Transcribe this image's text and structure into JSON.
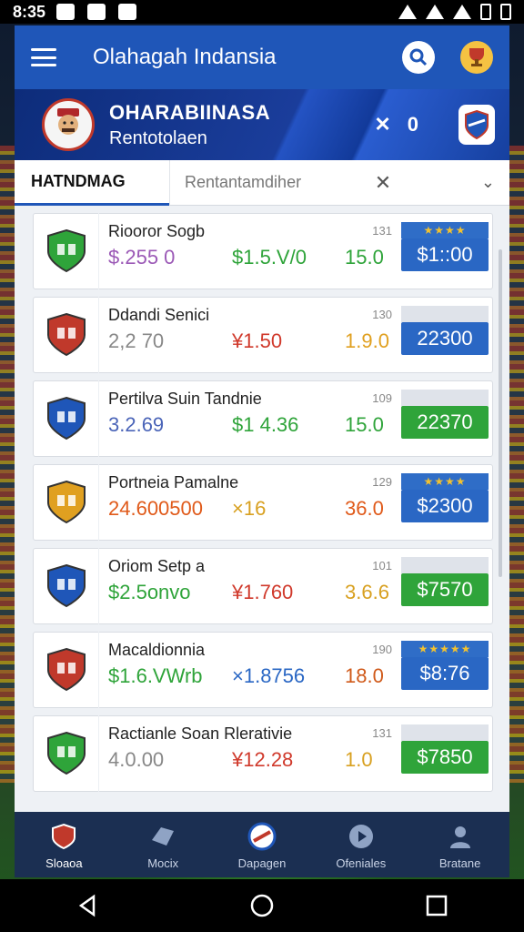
{
  "status_bar": {
    "time": "8:35"
  },
  "app": {
    "title": "Olahagah Indansia"
  },
  "hero": {
    "title": "OHARABIINASA",
    "subtitle": "Rentotolaen",
    "score_left": "✕",
    "score_right": "0"
  },
  "tabs": {
    "active": "HATNDMAG",
    "inactive": "Rentantamdiher",
    "close": "✕",
    "chevron": "⌄"
  },
  "cards": [
    {
      "name": "Riooror Sogb",
      "count": "131",
      "v1": "$.255 0",
      "v2": "$1.5.V/0",
      "v3": "15.0",
      "price": "$1::00",
      "stars": "★★★★",
      "price_color": "#2a67c4"
    },
    {
      "name": "Ddandi Senici",
      "count": "130",
      "v1": "2,2 70",
      "v2": "¥1.50",
      "v3": "1.9.0",
      "price": "22300",
      "stars": "",
      "price_color": "#2a67c4"
    },
    {
      "name": "Pertilva Suin Tandnie",
      "count": "109",
      "v1": "3.2.69",
      "v2": "$1 4.36",
      "v3": "15.0",
      "price": "22370",
      "stars": "",
      "price_color": "#2fa43a"
    },
    {
      "name": "Portneia Pamalne",
      "count": "129",
      "v1": "24.600500",
      "v2": "×16",
      "v3": "36.0",
      "price": "$2300",
      "stars": "★★★★",
      "price_color": "#2a67c4"
    },
    {
      "name": "Oriom Setp a",
      "count": "101",
      "v1": "$2.5onvo",
      "v2": "¥1.760",
      "v3": "3.6.6",
      "price": "$7570",
      "stars": "",
      "price_color": "#2fa43a"
    },
    {
      "name": "Macaldionnia",
      "count": "190",
      "v1": "$1.6.VWrb",
      "v2": "×1.8756",
      "v3": "18.0",
      "price": "$8:76",
      "stars": "★★★★★",
      "price_color": "#2a67c4"
    },
    {
      "name": "Ractianle Soan Rlerativie",
      "count": "131",
      "v1": "4.0.00",
      "v2": "¥12.28",
      "v3": "1.0",
      "price": "$7850",
      "stars": "",
      "price_color": "#2fa43a"
    }
  ],
  "bottom_nav": [
    {
      "label": "Sloaoa"
    },
    {
      "label": "Mocix"
    },
    {
      "label": "Dapagen"
    },
    {
      "label": "Ofeniales"
    },
    {
      "label": "Bratane"
    }
  ],
  "colors": {
    "primary": "#1f56b8",
    "v1_colors": [
      "#9b59b6",
      "#888888",
      "#4a64b8",
      "#e05a1a",
      "#2fa43a",
      "#2fa43a",
      "#888888"
    ],
    "v2_colors": [
      "#2fa43a",
      "#d0392b",
      "#2fa43a",
      "#d8a020",
      "#d0392b",
      "#2a67c4",
      "#d0392b"
    ],
    "v3_colors": [
      "#2fa43a",
      "#e0a020",
      "#2fa43a",
      "#e05a1a",
      "#d8a020",
      "#d05a1a",
      "#d8a020"
    ]
  }
}
